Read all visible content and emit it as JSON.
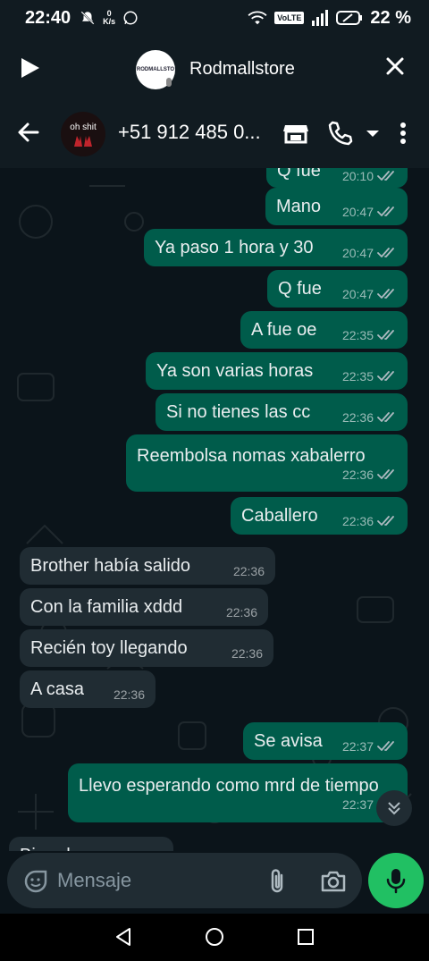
{
  "status_bar": {
    "time": "22:40",
    "speed_top": "0",
    "speed_unit": "K/s",
    "volte": "VoLTE",
    "battery": "22 %"
  },
  "top_bar": {
    "store_logo_text": "RODMALLSTO",
    "store_name": "Rodmallstore",
    "progress_fraction": 0.9
  },
  "header": {
    "avatar_text": "oh shit",
    "contact_title": "+51 912 485 0..."
  },
  "messages": [
    {
      "dir": "out",
      "text": "Q fue",
      "time": "20:10"
    },
    {
      "dir": "out",
      "text": "Mano",
      "time": "20:47"
    },
    {
      "dir": "out",
      "text": "Ya paso 1 hora y 30",
      "time": "20:47"
    },
    {
      "dir": "out",
      "text": "Q fue",
      "time": "20:47"
    },
    {
      "dir": "out",
      "text": "A fue oe",
      "time": "22:35"
    },
    {
      "dir": "out",
      "text": "Ya son varias horas",
      "time": "22:35"
    },
    {
      "dir": "out",
      "text": "Si no tienes las cc",
      "time": "22:36"
    },
    {
      "dir": "out",
      "text": "Reembolsa nomas xabalerro",
      "time": "22:36"
    },
    {
      "dir": "out",
      "text": "Caballero",
      "time": "22:36"
    },
    {
      "dir": "in",
      "text": "Brother había salido",
      "time": "22:36"
    },
    {
      "dir": "in",
      "text": "Con la familia xddd",
      "time": "22:36"
    },
    {
      "dir": "in",
      "text": "Recién toy llegando",
      "time": "22:36"
    },
    {
      "dir": "in",
      "text": "A casa",
      "time": "22:36"
    },
    {
      "dir": "out",
      "text": "Se avisa",
      "time": "22:37"
    },
    {
      "dir": "out",
      "text": "Llevo esperando como mrd de tiempo",
      "time": "22:37"
    },
    {
      "dir": "in",
      "text": "Bien d...",
      "time": ""
    }
  ],
  "composer": {
    "placeholder": "Mensaje"
  },
  "colors": {
    "outgoing_bubble": "#005c4b",
    "incoming_bubble": "#202c33",
    "background": "#0b141a",
    "mic_button": "#21c063"
  }
}
